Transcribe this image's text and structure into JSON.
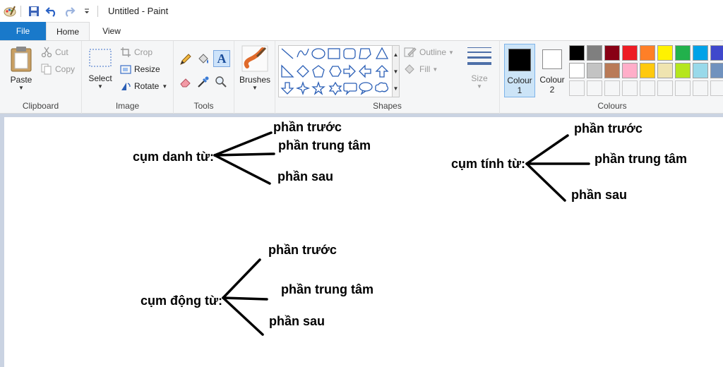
{
  "window": {
    "title": "Untitled - Paint"
  },
  "tabs": {
    "file": "File",
    "home": "Home",
    "view": "View"
  },
  "clipboard": {
    "paste": "Paste",
    "cut": "Cut",
    "copy": "Copy",
    "label": "Clipboard"
  },
  "image": {
    "select": "Select",
    "crop": "Crop",
    "resize": "Resize",
    "rotate": "Rotate",
    "label": "Image"
  },
  "tools": {
    "label": "Tools"
  },
  "brushes": {
    "label": "Brushes"
  },
  "shapes": {
    "outline": "Outline",
    "fill": "Fill",
    "label": "Shapes"
  },
  "size": {
    "label": "Size"
  },
  "colours": {
    "colour1": "Colour",
    "colour1_num": "1",
    "colour2": "Colour",
    "colour2_num": "2",
    "label": "Colours",
    "colour1_value": "#000000",
    "colour2_value": "#ffffff",
    "palette_row1": [
      "#000000",
      "#7f7f7f",
      "#880015",
      "#ed1c24",
      "#ff7f27",
      "#fff200",
      "#22b14c",
      "#00a2e8",
      "#3f48cc"
    ],
    "palette_row2": [
      "#ffffff",
      "#c3c3c3",
      "#b97a57",
      "#ffaec9",
      "#ffc90e",
      "#efe4b0",
      "#b5e61d",
      "#99d9ea",
      "#7092be"
    ]
  },
  "canvas": {
    "noun_phrase": {
      "root": "cụm danh từ:",
      "before": "phần trước",
      "center": "phần trung tâm",
      "after": "phần sau"
    },
    "adjective_phrase": {
      "root": "cụm tính từ:",
      "before": "phần trước",
      "center": "phần trung tâm",
      "after": "phần sau"
    },
    "verb_phrase": {
      "root": "cụm động từ:",
      "before": "phần trước",
      "center": "phần trung tâm",
      "after": "phần sau"
    }
  }
}
